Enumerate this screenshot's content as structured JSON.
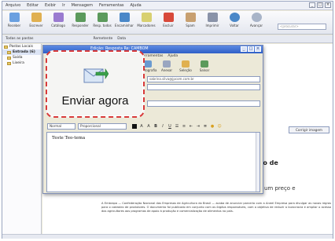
{
  "main_window": {
    "menu": [
      "Arquivo",
      "Editar",
      "Exibir",
      "Ir",
      "Mensagem",
      "Ferramentas",
      "Ajuda"
    ],
    "toolbar": [
      "Receber",
      "Escrever",
      "Catálogo",
      "Responder",
      "Resp. todos",
      "Encaminhar",
      "Marcadores",
      "Excluir",
      "Spam",
      "Imprimir",
      "Voltar",
      "Avançar"
    ],
    "search_placeholder": "<procurar>",
    "filter": {
      "view_label": "Todas as pastas",
      "from_label": "Remetente",
      "date_label": "Data"
    },
    "folders": [
      "Pastas Locais",
      "Entrada (6)",
      "Saída",
      "Lixeira"
    ],
    "preview_title": "ão de",
    "preview_subtitle": "um preço e",
    "news_text": "A Embrapa — Confederação Nacional das Empresas de Agricultura do Brasil — acaba de anunciar parceria com a Aneel Empresa para divulgar as novas regras para o cadastro de produtores. O documento foi publicado em conjunto com os órgãos responsáveis, com o objetivo de reduzir a burocracia e ampliar o acesso dos agricultores aos programas de apoio à produção e comercialização de alimentos no país."
  },
  "compose": {
    "title": "Edição: Resposta Re: CAMBOM",
    "menu": [
      "Ferramentas",
      "Ajuda"
    ],
    "toolbar": [
      "Ortografia",
      "Anexar",
      "Seleção",
      "Salvar"
    ],
    "to_field": "sabrina.silva@jpcom.com.br",
    "font_select": "Normal",
    "width_select": "Proporcional",
    "format_buttons": [
      "A",
      "A",
      "B",
      "I",
      "U"
    ],
    "body_text": "Teste Teo-tema",
    "side_button": "Corrigir imagem"
  },
  "callout": {
    "label": "Enviar agora"
  },
  "colors": {
    "callout_border": "#d83a3a",
    "title_bar": "#2f5fc7"
  }
}
